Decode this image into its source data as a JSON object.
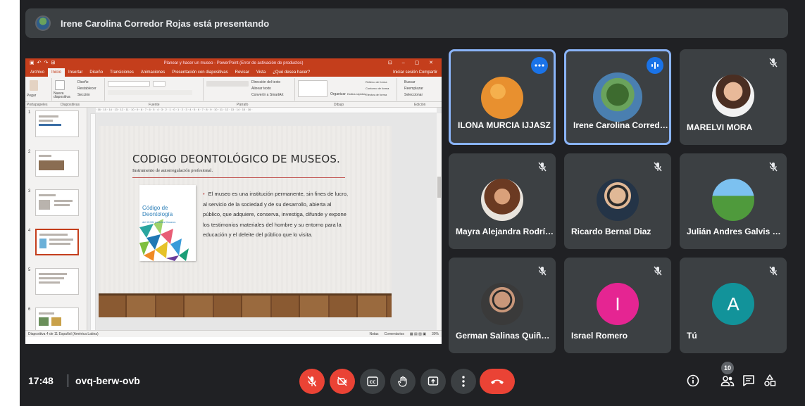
{
  "presenter_bar": {
    "text": "Irene Carolina Corredor Rojas está presentando"
  },
  "powerpoint": {
    "window_title": "Planear y hacer un museo - PowerPoint (Error de activación de productos)",
    "tabs": [
      "Archivo",
      "Inicio",
      "Insertar",
      "Diseño",
      "Transiciones",
      "Animaciones",
      "Presentación con diapositivas",
      "Revisar",
      "Vista",
      "¿Qué desea hacer?"
    ],
    "active_tab": "Inicio",
    "right_tabs": "Iniciar sesión   Compartir",
    "groups": [
      "Portapapeles",
      "Diapositivas",
      "Fuente",
      "Párrafo",
      "Dibujo",
      "Edición"
    ],
    "ribbon_labels": {
      "design": "Diseño",
      "restore": "Restablecer",
      "section": "Sección",
      "new_slide": "Nueva diapositiva",
      "paste": "Pegar",
      "find": "Buscar",
      "replace": "Reemplazar",
      "select": "Seleccionar",
      "text_direction": "Dirección del texto",
      "align_text": "Alinear texto",
      "smartart": "Convertir a SmartArt",
      "arrange": "Organizar",
      "quick_styles": "Estilos rápidos",
      "shape_fill": "Relleno de forma",
      "shape_outline": "Contorno de forma",
      "shape_effects": "Efectos de forma"
    },
    "slide_numbers": [
      "1",
      "2",
      "3",
      "4",
      "5",
      "6"
    ],
    "slide": {
      "title": "CODIGO DEONTOLÓGICO DE MUSEOS.",
      "subtitle": "Instrumento de autorregulación profesional.",
      "bullet": "El museo es una institución permanente, sin fines de lucro, al servicio de la sociedad y de su desarrollo, abierta al público, que adquiere, conserva, investiga, difunde y expone los testimonios materiales del hombre y su entorno para la educación y el deleite del público que lo visita.",
      "book_title": "Código de Deontología",
      "book_sub": "del ICOM para los Museos"
    },
    "status_left": "Diapositiva 4 de 11     Español (América Latina)",
    "status_notes": "Notas",
    "status_comments": "Comentarios",
    "zoom": "30%"
  },
  "tiles": [
    {
      "name": "ILONA MURCIA IJJASZ",
      "state": "more-options",
      "avatar_color": "#e8902f"
    },
    {
      "name": "Irene Carolina Corredor...",
      "state": "speaking",
      "avatar_color": "#4a7fb0"
    },
    {
      "name": "MARELVI MORA",
      "state": "muted",
      "avatar_color": "#c98b62"
    },
    {
      "name": "Mayra Alejandra Rodríg...",
      "state": "muted",
      "avatar_color": "#a0522d"
    },
    {
      "name": "Ricardo Bernal Diaz",
      "state": "muted",
      "avatar_color": "#3b4d66"
    },
    {
      "name": "Julián Andres Galvis Pa...",
      "state": "muted",
      "avatar_color": "#5aa9e6"
    },
    {
      "name": "German Salinas Quiñon...",
      "state": "muted",
      "avatar_color": "#5a5a5a"
    },
    {
      "name": "Israel Romero",
      "state": "muted",
      "avatar_letter": "I",
      "avatar_color": "#e52592"
    },
    {
      "name": "Tú",
      "state": "muted",
      "avatar_letter": "A",
      "avatar_color": "#12939a"
    }
  ],
  "bottom_bar": {
    "time": "17:48",
    "meeting_code": "ovq-berw-ovb",
    "participants_count": "10"
  },
  "colors": {
    "background": "#202124",
    "tile": "#3c4043",
    "danger": "#ea4335",
    "speaking_border": "#8ab4f8"
  }
}
